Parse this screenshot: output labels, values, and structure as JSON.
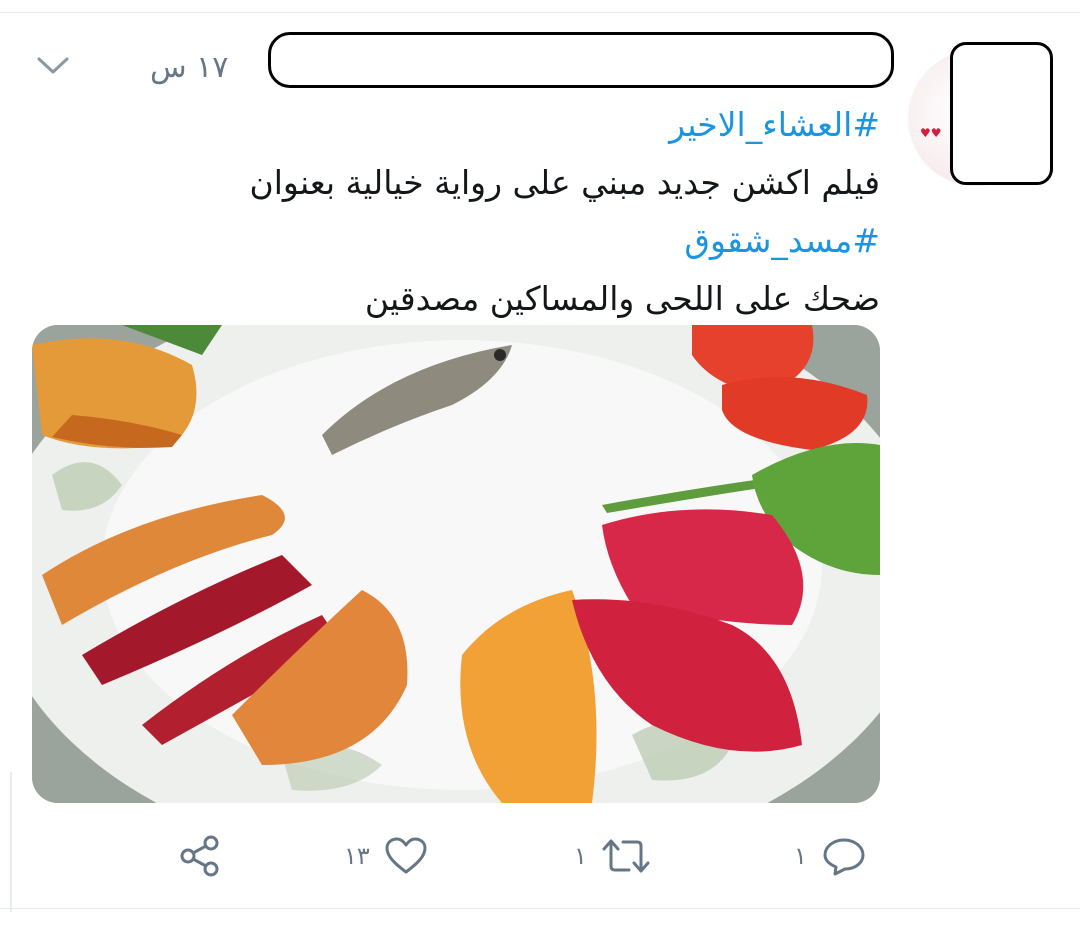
{
  "tweet": {
    "time": "١٧ س",
    "hashtag_1": "#العشاء_الاخير",
    "line_1": "فيلم اكشن جديد مبني على رواية خيالية بعنوان",
    "hashtag_2": "#مسد_شقوق",
    "line_2": "ضحك على اللحى والمساكين مصدقين"
  },
  "actions": {
    "reply_count": "١",
    "retweet_count": "١",
    "like_count": "١٣"
  },
  "colors": {
    "link": "#1b95e0",
    "muted": "#657786",
    "text": "#14171a"
  },
  "icons": {
    "menu": "chevron-down-icon",
    "reply": "reply-icon",
    "retweet": "retweet-icon",
    "like": "heart-icon",
    "share": "share-icon"
  }
}
